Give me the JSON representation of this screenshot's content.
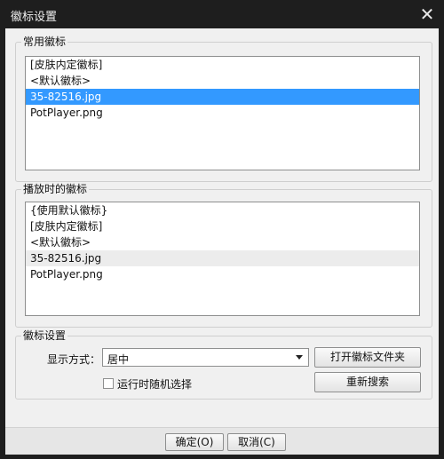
{
  "window": {
    "title": "徽标设置",
    "close_glyph": "✕",
    "close_icon": "close-icon"
  },
  "common_logos": {
    "legend": "常用徽标",
    "items": [
      {
        "label": "[皮肤内定徽标]",
        "state": "normal"
      },
      {
        "label": "<默认徽标>",
        "state": "normal"
      },
      {
        "label": "35-82516.jpg",
        "state": "selected"
      },
      {
        "label": "PotPlayer.png",
        "state": "normal"
      }
    ]
  },
  "playback_logos": {
    "legend": "播放时的徽标",
    "items": [
      {
        "label": "{使用默认徽标}",
        "state": "normal"
      },
      {
        "label": "[皮肤内定徽标]",
        "state": "normal"
      },
      {
        "label": "<默认徽标>",
        "state": "normal"
      },
      {
        "label": "35-82516.jpg",
        "state": "hover"
      },
      {
        "label": "PotPlayer.png",
        "state": "normal"
      }
    ]
  },
  "logo_settings": {
    "legend": "徽标设置",
    "display_mode_label": "显示方式：",
    "display_mode_value": "居中",
    "open_folder_button": "打开徽标文件夹",
    "random_checkbox_label": "运行时随机选择",
    "random_checked": false,
    "refresh_button": "重新搜索"
  },
  "footer": {
    "ok_button": "确定(O)",
    "cancel_button": "取消(C)"
  },
  "colors": {
    "selection": "#3399ff",
    "titlebar": "#1e1e1e",
    "dialog_background": "#f0f0f0"
  }
}
